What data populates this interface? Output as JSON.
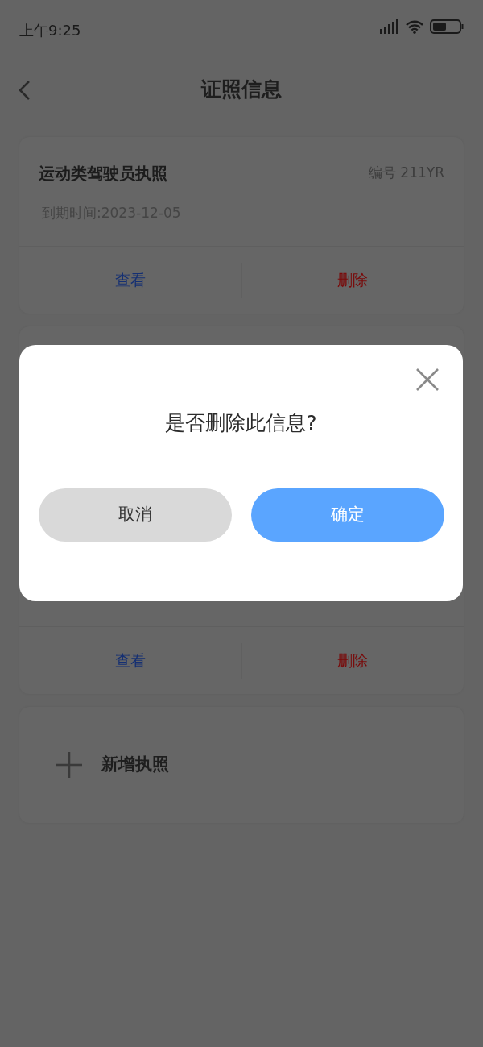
{
  "status_bar": {
    "time": "上午9:25"
  },
  "header": {
    "title": "证照信息"
  },
  "licenses": [
    {
      "name": "运动类驾驶员执照",
      "number": "编号 211YR",
      "expiry": "到期时间:2023-12-05",
      "actions": [
        {
          "label": "查看",
          "kind": "view"
        },
        {
          "label": "删除",
          "kind": "delete"
        }
      ]
    },
    {
      "actions": [
        {
          "label": "查看",
          "kind": "view"
        },
        {
          "label": "删除",
          "kind": "delete"
        }
      ]
    }
  ],
  "add_button": {
    "label": "新增执照"
  },
  "dialog": {
    "message": "是否删除此信息?",
    "buttons": [
      {
        "label": "取消",
        "kind": "cancel"
      },
      {
        "label": "确定",
        "kind": "confirm"
      }
    ]
  }
}
